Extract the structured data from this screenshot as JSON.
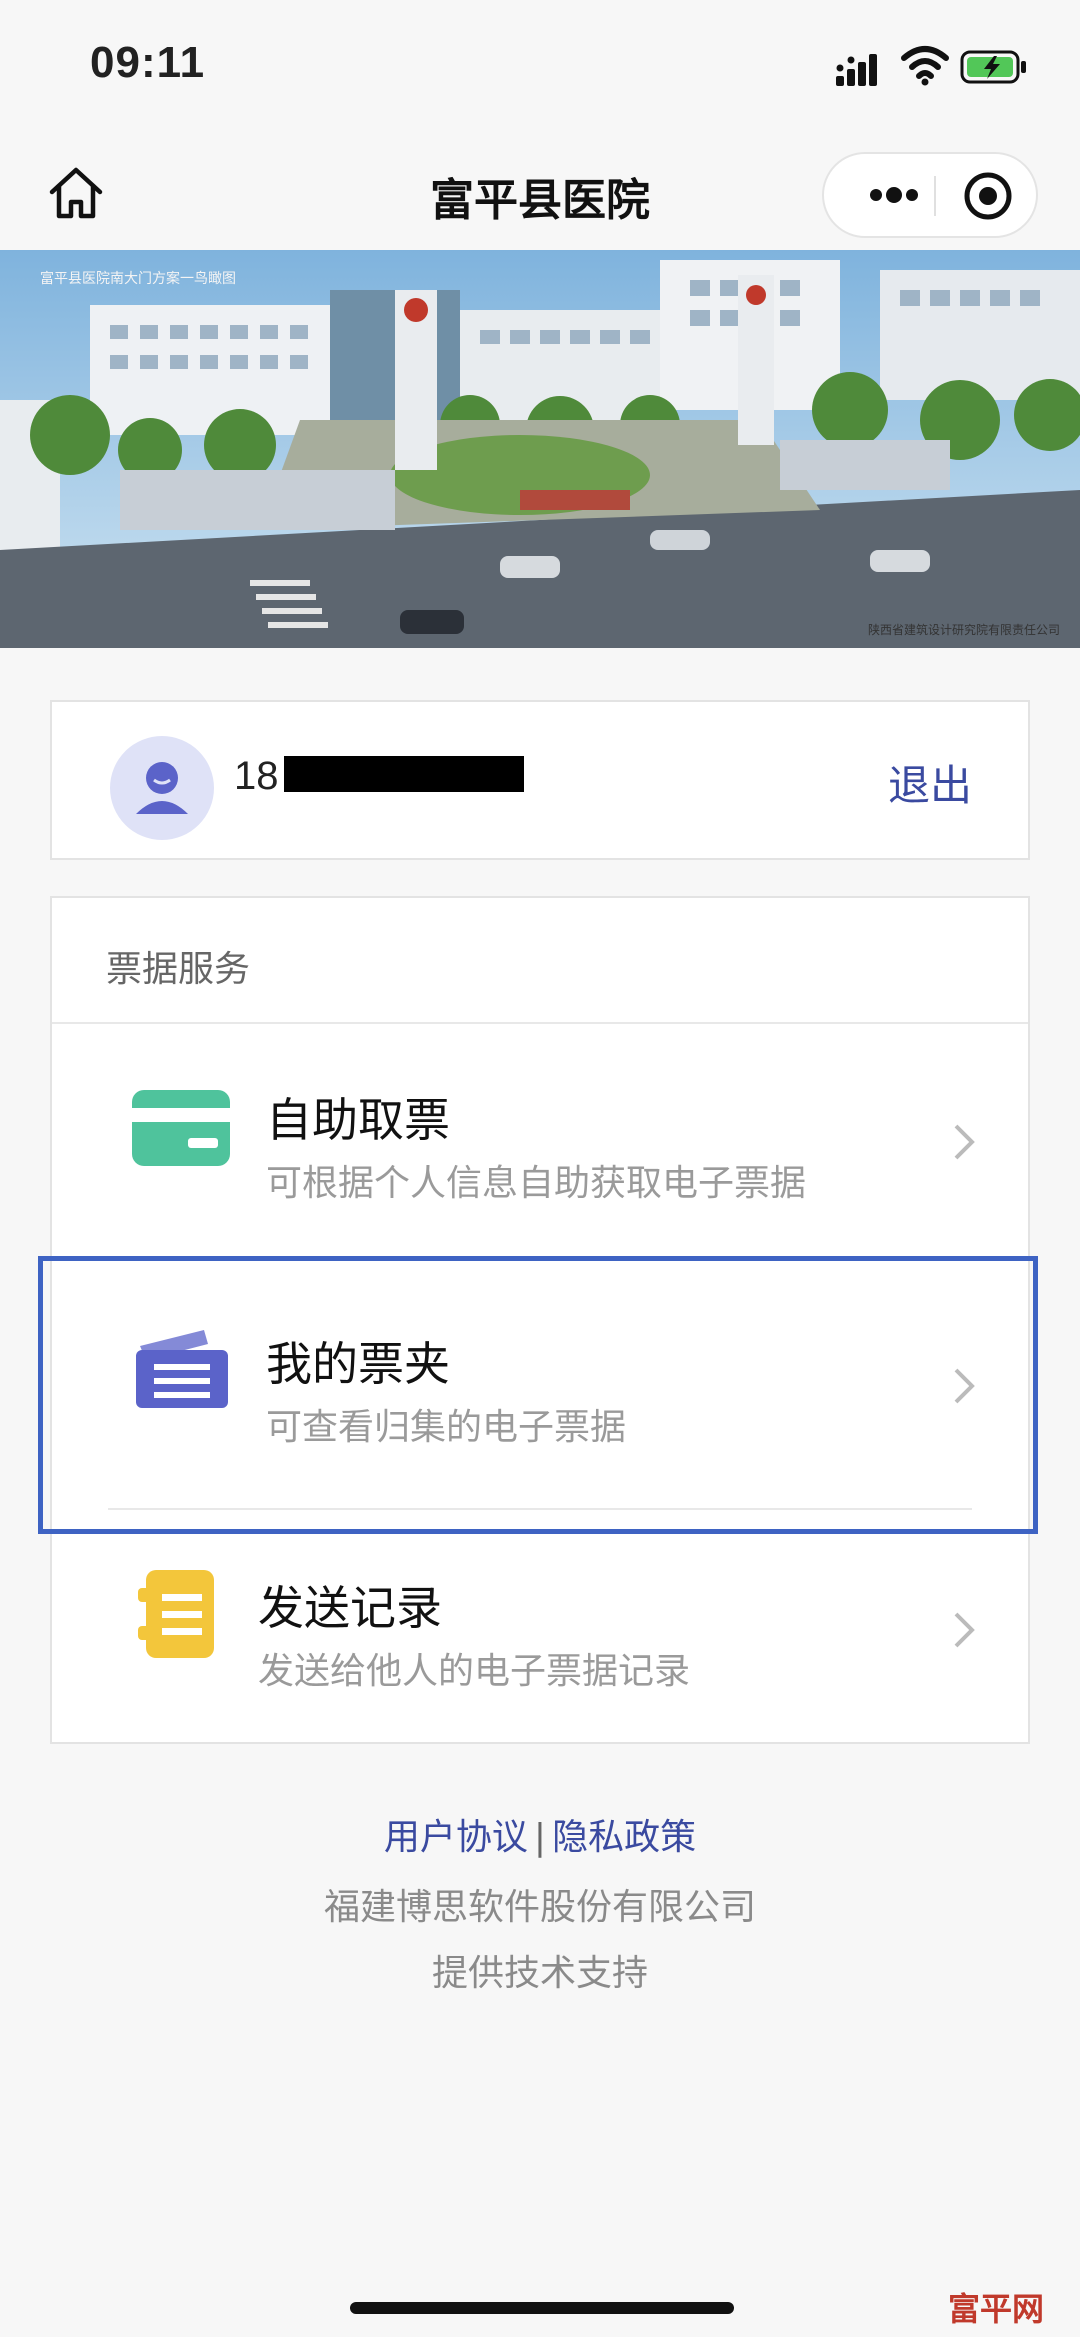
{
  "status_bar": {
    "time": "09:11"
  },
  "nav": {
    "title": "富平县医院"
  },
  "banner": {
    "caption": "富平县医院南大门方案一鸟瞰图",
    "credit": "陕西省建筑设计研究院有限责任公司"
  },
  "user": {
    "phone_prefix": "18",
    "logout_label": "退出"
  },
  "services": {
    "header": "票据服务",
    "items": [
      {
        "title": "自助取票",
        "desc": "可根据个人信息自助获取电子票据",
        "icon": "ticket-card-icon",
        "color": "#4fc39c"
      },
      {
        "title": "我的票夹",
        "desc": "可查看归集的电子票据",
        "icon": "wallet-icon",
        "color": "#5b63c9"
      },
      {
        "title": "发送记录",
        "desc": "发送给他人的电子票据记录",
        "icon": "record-icon",
        "color": "#f3c63b"
      }
    ]
  },
  "footer": {
    "user_agreement": "用户协议",
    "separator": "|",
    "privacy_policy": "隐私政策",
    "company": "福建博思软件股份有限公司",
    "support": "提供技术支持"
  },
  "watermark": {
    "text": "富平网"
  },
  "colors": {
    "accent": "#3a4aa0",
    "highlight": "#3e63c3"
  }
}
